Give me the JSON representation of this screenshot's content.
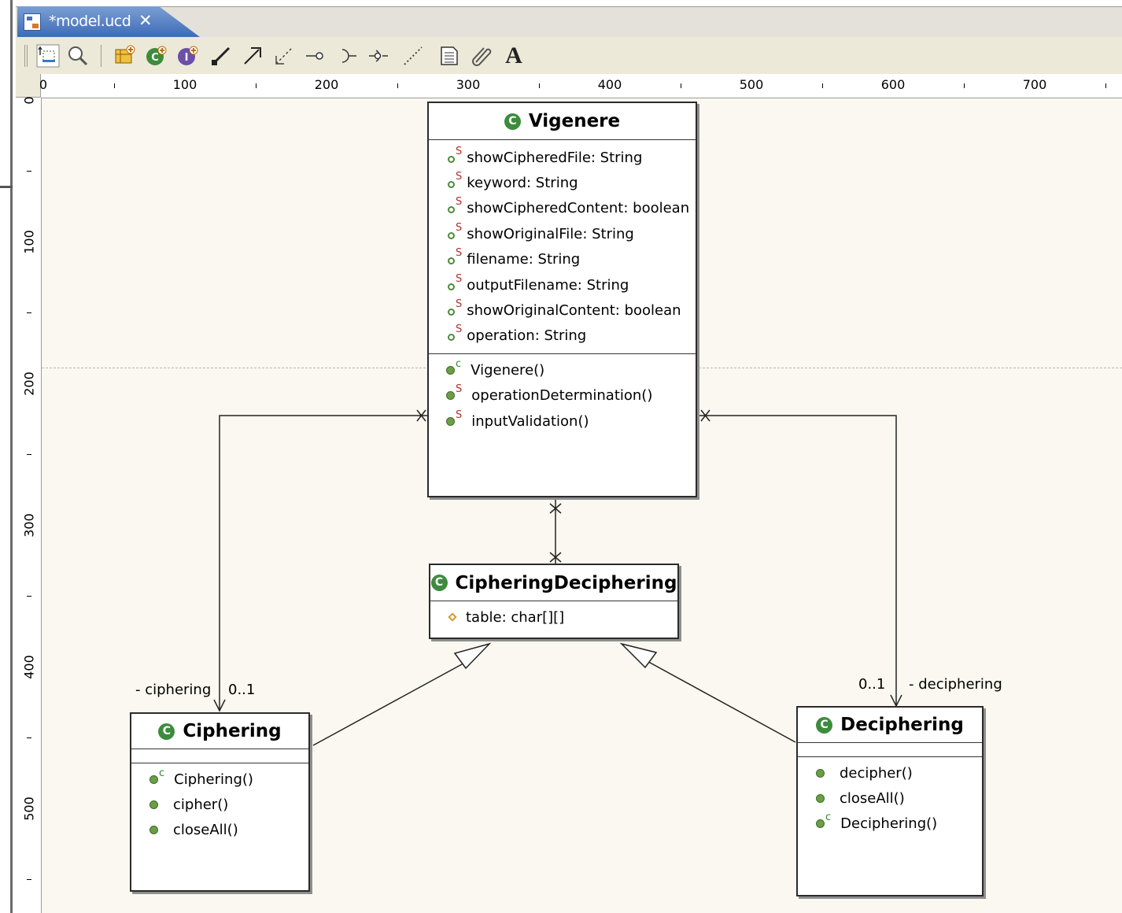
{
  "tab": {
    "title": "*model.ucd",
    "close": "✕"
  },
  "toolbar": {
    "tools": [
      "select-tool",
      "zoom-tool",
      "package-tool",
      "class-tool",
      "interface-tool",
      "association-tool",
      "generalization-tool",
      "dependency-tool",
      "provided-interface-tool",
      "required-interface-tool",
      "port-tool",
      "note-link-tool",
      "note-tool",
      "link-tool",
      "text-tool"
    ],
    "text_tool_glyph": "A"
  },
  "ruler": {
    "horizontal": [
      "0",
      "100",
      "200",
      "300",
      "400",
      "500",
      "600",
      "700"
    ],
    "vertical": [
      "0",
      "100",
      "200",
      "300",
      "400",
      "500"
    ]
  },
  "diagram": {
    "vigenere": {
      "name": "Vigenere",
      "attributes": [
        "showCipheredFile: String",
        "keyword: String",
        "showCipheredContent: boolean",
        "showOriginalFile: String",
        "filename: String",
        "outputFilename: String",
        "showOriginalContent: boolean",
        "operation: String"
      ],
      "operations": [
        "Vigenere()",
        "operationDetermination()",
        "inputValidation()"
      ]
    },
    "ciphering_deciphering": {
      "name": "CipheringDeciphering",
      "attributes": [
        "table: char[][]"
      ]
    },
    "ciphering": {
      "name": "Ciphering",
      "operations": [
        "Ciphering()",
        "cipher()",
        "closeAll()"
      ]
    },
    "deciphering": {
      "name": "Deciphering",
      "operations": [
        "decipher()",
        "closeAll()",
        "Deciphering()"
      ]
    },
    "labels": {
      "ciphering_role": "- ciphering",
      "ciphering_mult": "0..1",
      "deciphering_mult": "0..1",
      "deciphering_role": "- deciphering"
    },
    "badge": "C",
    "static_marker": "S",
    "constructor_marker": "c"
  }
}
